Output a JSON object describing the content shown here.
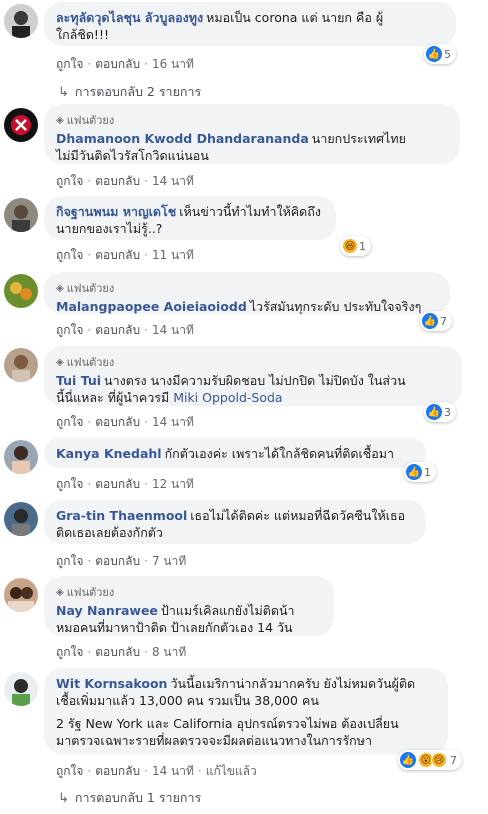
{
  "labels": {
    "like": "ถูกใจ",
    "reply": "ตอบกลับ",
    "fan": "แฟนตัวยง",
    "see_translation": "แก้ไขแล้ว"
  },
  "comments": [
    {
      "author": "ละทุลัดวุดไลชุน ลัวบูลองทูง",
      "lines": [
        "หมอเป็น corona แต่ นายก คือ ผู้",
        "ใกล้ชิด!!!"
      ],
      "time": "16 นาที",
      "reaction_icons": [
        "like-icon"
      ],
      "reaction_count": "5",
      "fan": false
    },
    {
      "author": "Dhamanoon Kwodd Dhandarananda",
      "lines": [
        "นายกประเทศไทย",
        "ไม่มีวันติดไวรัสโกวิดแน่นอน"
      ],
      "time": "14 นาที",
      "fan": true
    },
    {
      "author": "กิจฐานพนม หาญเดโช",
      "lines": [
        "เห็นข่าวนี้ทำไมทำให้คิดถึง",
        "นายกของเราไม่รู้..?"
      ],
      "time": "11 นาที",
      "reaction_icons": [
        "haha-icon"
      ],
      "reaction_count": "1",
      "fan": false
    },
    {
      "author": "Malangpaopee Aoieiaoiodd",
      "lines": [
        "ไวรัสมันทุกระดับ ประทับใจจริงๆ"
      ],
      "time": "14 นาที",
      "reaction_icons": [
        "like-icon"
      ],
      "reaction_count": "7",
      "fan": true
    },
    {
      "author": "Tui Tui",
      "lines": [
        "นางตรง นางมีความรับผิดชอบ ไม่ปกปิด ไม่ปิดบัง ในส่วน",
        "นี้นี่แหละ ที่ผู้นำควรมี"
      ],
      "mention": "Miki Oppold-Soda",
      "time": "14 นาที",
      "reaction_icons": [
        "like-icon"
      ],
      "reaction_count": "3",
      "fan": true
    },
    {
      "author": "Kanya Knedahl",
      "lines": [
        "กักตัวเองค่ะ เพราะได้ใกล้ชิดคนที่ติดเชื้อมา"
      ],
      "time": "12 นาที",
      "reaction_icons": [
        "like-icon"
      ],
      "reaction_count": "1",
      "fan": false
    },
    {
      "author": "Gra-tin Thaenmool",
      "lines": [
        "เธอไม่ได้ติดค่ะ แต่หมอที่ฉีดวัคซีนให้เธอ",
        "ติดเธอเลยต้องกักตัว"
      ],
      "time": "7 นาที",
      "fan": false
    },
    {
      "author": "Nay Nanrawee",
      "lines": [
        "ป้าแมร์เคิลแกยังไม่ติดน้า",
        "หมอคนที่มาหาป้าติด ป้าเลยกักตัวเอง 14 วัน"
      ],
      "time": "8 นาที",
      "fan": true
    },
    {
      "author": "Wit Kornsakoon",
      "lines": [
        "วันนี้อเมริกาน่ากลัวมากครับ ยังไม่หมดวันผู้ติด",
        "เชื้อเพิ่มมาแล้ว 13,000 คน รวมเป็น 38,000 คน",
        "",
        "2 รัฐ New York และ California อุปกรณ์ตรวจไม่พอ ต้องเปลี่ยน",
        "มาตรวจเฉพาะรายที่ผลตรวจจะมีผลต่อแนวทางในการรักษา"
      ],
      "time": "14 นาที",
      "edited": "แก้ไขแล้ว",
      "reaction_icons": [
        "like-icon",
        "wow-icon",
        "sad-icon"
      ],
      "reaction_count": "7",
      "fan": false
    }
  ],
  "replies": [
    {
      "text": "การตอบกลับ 2 รายการ"
    },
    {
      "text": "การตอบกลับ 1 รายการ"
    }
  ],
  "colors": {
    "author": "#385898",
    "bubble": "#f2f3f5",
    "like": "#1877f2"
  }
}
